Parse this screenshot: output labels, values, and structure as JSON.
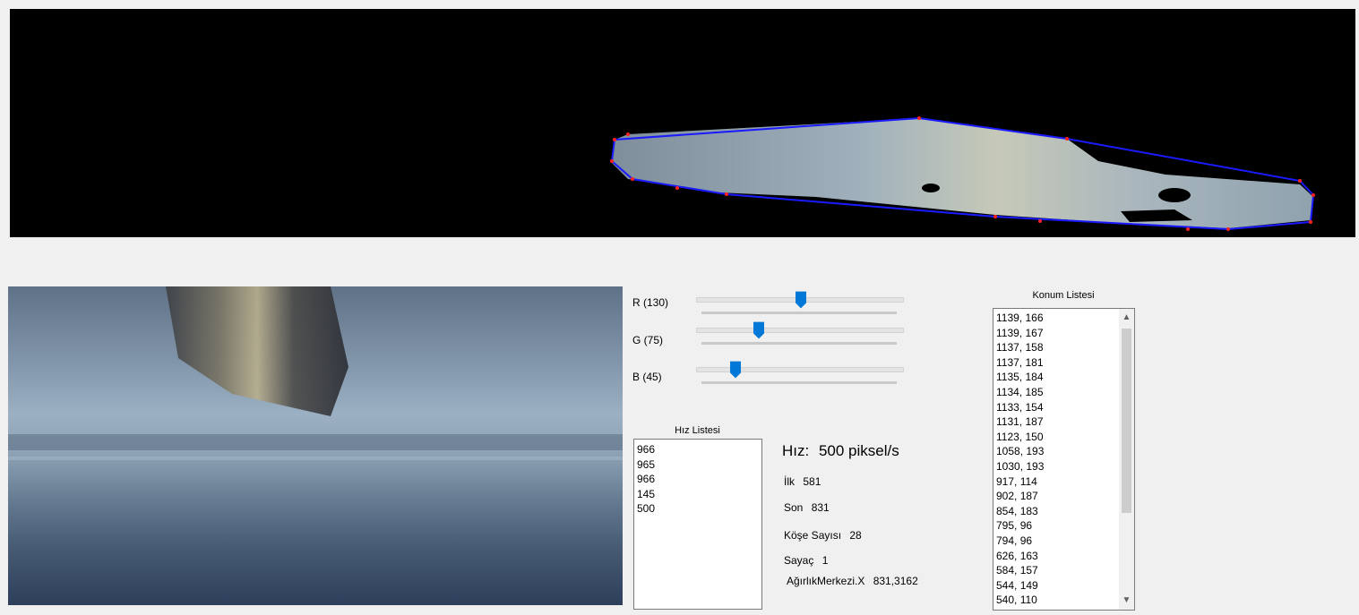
{
  "trackbars": [
    {
      "label": "R (130)",
      "value": 130,
      "max": 255
    },
    {
      "label": "G (75)",
      "value": 75,
      "max": 255
    },
    {
      "label": "B (45)",
      "value": 45,
      "max": 255
    }
  ],
  "speed_list": {
    "title": "Hız Listesi",
    "items": [
      "966",
      "965",
      "966",
      "145",
      "500"
    ]
  },
  "position_list": {
    "title": "Konum Listesi",
    "items": [
      "1139, 166",
      "1139, 167",
      "1137, 158",
      "1137, 181",
      "1135, 184",
      "1134, 185",
      "1133, 154",
      "1131, 187",
      "1123, 150",
      "1058, 193",
      "1030, 193",
      "917, 114",
      "902, 187",
      "854, 183",
      "795, 96",
      "794, 96",
      "626, 163",
      "584, 157",
      "544, 149",
      "540, 110"
    ]
  },
  "info": {
    "speed_label": "Hız:",
    "speed_value": "500 piksel/s",
    "first_label": "İlk",
    "first_value": "581",
    "last_label": "Son",
    "last_value": "831",
    "corners_label": "Köşe Sayısı",
    "corners_value": "28",
    "counter_label": "Sayaç",
    "counter_value": "1",
    "centroid_label": "AğırlıkMerkezi.X",
    "centroid_value": "831,3162"
  },
  "colors": {
    "thumb": "#0078d7",
    "hull": "#1a1aff",
    "corner_points": "#ff2020",
    "window_bg": "#f0f0f0"
  }
}
